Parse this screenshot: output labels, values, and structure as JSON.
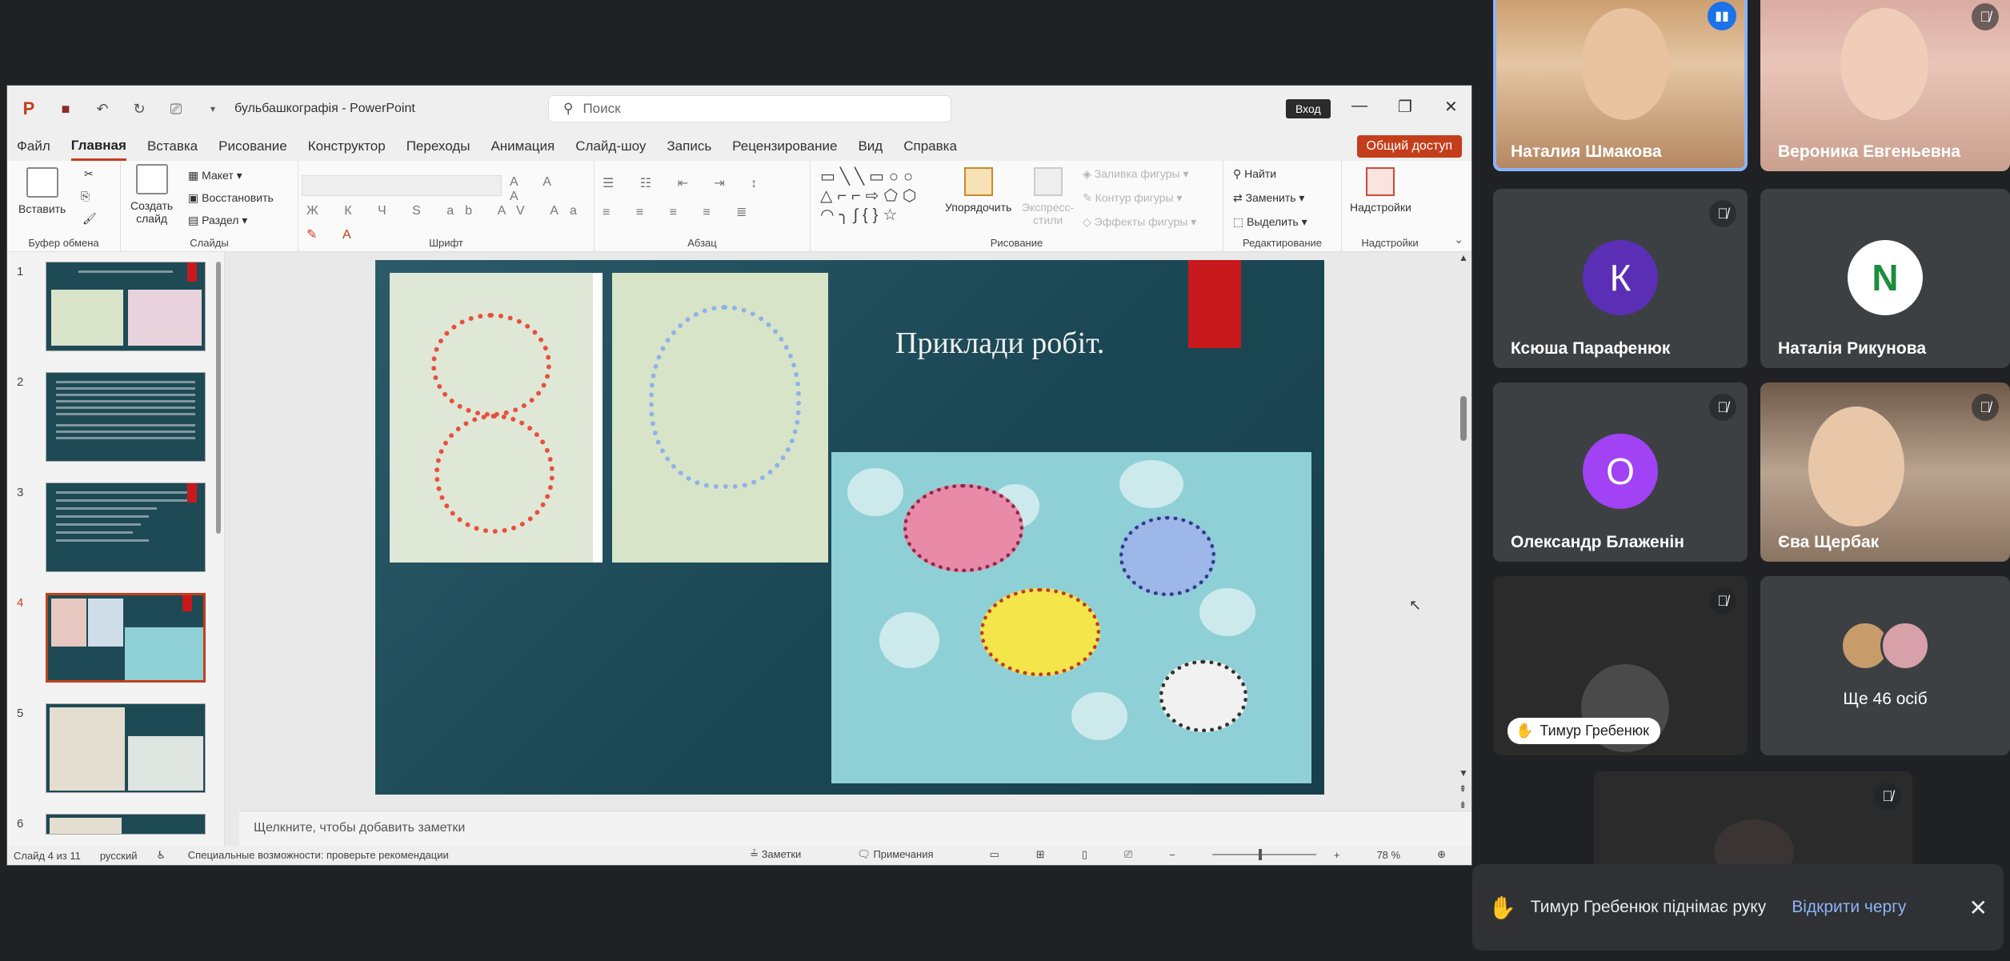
{
  "ppt": {
    "title": "бульбашкографія - PowerPoint",
    "search_placeholder": "Поиск",
    "signin": "Вход",
    "menu": [
      "Файл",
      "Главная",
      "Вставка",
      "Рисование",
      "Конструктор",
      "Переходы",
      "Анимация",
      "Слайд-шоу",
      "Запись",
      "Рецензирование",
      "Вид",
      "Справка"
    ],
    "share": "Общий доступ",
    "ribbon": {
      "paste": "Вставить",
      "new_slide_1": "Создать",
      "new_slide_2": "слайд",
      "layout": "Макет",
      "reset": "Восстановить",
      "section": "Раздел",
      "arrange": "Упорядочить",
      "quick_styles_1": "Экспресс-",
      "quick_styles_2": "стили",
      "shape_fill": "Заливка фигуры",
      "shape_outline": "Контур фигуры",
      "shape_effects": "Эффекты фигуры",
      "find": "Найти",
      "replace": "Заменить",
      "select": "Выделить",
      "addins": "Надстройки",
      "group_clipboard": "Буфер обмена",
      "group_slides": "Слайды",
      "group_font": "Шрифт",
      "group_paragraph": "Абзац",
      "group_drawing": "Рисование",
      "group_editing": "Редактирование",
      "group_addins": "Надстройки"
    },
    "thumbnails": [
      "1",
      "2",
      "3",
      "4",
      "5",
      "6"
    ],
    "active_slide": 4,
    "slide_title": "Приклади робіт.",
    "notes_placeholder": "Щелкните, чтобы добавить заметки",
    "status": {
      "slide_counter": "Слайд 4 из 11",
      "language": "русский",
      "accessibility": "Специальные возможности: проверьте рекомендации",
      "notes": "Заметки",
      "comments": "Примечания",
      "zoom": "78 %"
    }
  },
  "meet": {
    "participants": [
      {
        "name": "Наталия Шмакова",
        "state": "speaking"
      },
      {
        "name": "Вероника Евгеньевна",
        "state": "muted"
      },
      {
        "name": "Ксюша Парафенюк",
        "initial": "К",
        "color": "#5b2fb5",
        "state": "muted"
      },
      {
        "name": "Наталія Рикунова",
        "initial": "N",
        "color": "#ffffff",
        "state": "none"
      },
      {
        "name": "Олександр Блаженін",
        "initial": "О",
        "color": "#a142f4",
        "state": "muted"
      },
      {
        "name": "Єва Щербак",
        "state": "muted"
      },
      {
        "name": "Тимур Гребенюк",
        "state": "muted_hand"
      },
      {
        "name": "",
        "state": "muted"
      }
    ],
    "more_label": "Ще 46 осіб",
    "toast": {
      "message": "Тимур Гребенюк піднімає руку",
      "action": "Відкрити чергу"
    }
  }
}
